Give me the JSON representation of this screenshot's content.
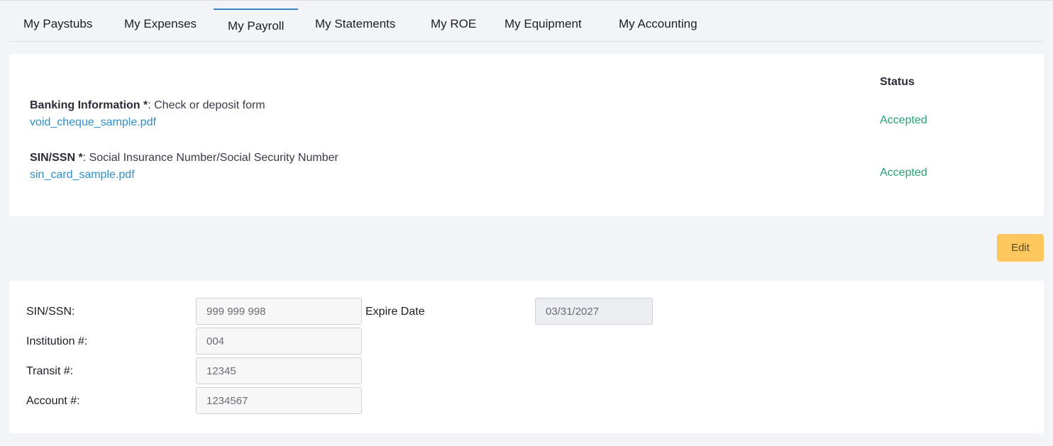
{
  "tabs": [
    {
      "label": "My Paystubs",
      "active": false
    },
    {
      "label": "My Expenses",
      "active": false
    },
    {
      "label": "My Payroll",
      "active": true
    },
    {
      "label": "My Statements",
      "active": false
    },
    {
      "label": "My ROE",
      "active": false
    },
    {
      "label": "My Equipment",
      "active": false
    },
    {
      "label": "My Accounting",
      "active": false
    }
  ],
  "documents": {
    "status_header": "Status",
    "items": [
      {
        "title": "Banking Information *",
        "description": ": Check or deposit form",
        "file": "void_cheque_sample.pdf",
        "status": "Accepted"
      },
      {
        "title": "SIN/SSN *",
        "description": ": Social Insurance Number/Social Security Number",
        "file": "sin_card_sample.pdf",
        "status": "Accepted"
      }
    ]
  },
  "toolbar": {
    "edit_label": "Edit"
  },
  "form": {
    "sin_label": "SIN/SSN:",
    "sin_value": "999 999 998",
    "expire_label": "Expire Date",
    "expire_value": "03/31/2027",
    "institution_label": "Institution #:",
    "institution_value": "004",
    "transit_label": "Transit #:",
    "transit_value": "12345",
    "account_label": "Account #:",
    "account_value": "1234567"
  },
  "colors": {
    "accent": "#3a84c4",
    "link": "#2d8fcf",
    "status_accepted": "#2aa074",
    "edit_button": "#fdc75d",
    "background": "#f3f4f7"
  }
}
